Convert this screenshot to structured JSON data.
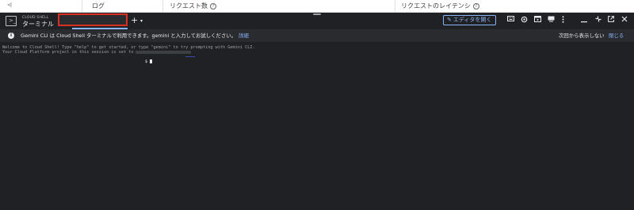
{
  "console_table": {
    "collapse_glyph": "<|",
    "col_logs": "ログ",
    "col_requests": "リクエスト数",
    "col_latency": "リクエストのレイテンシ",
    "help_glyph": "?"
  },
  "toolbar": {
    "brand_small": "CLOUD SHELL",
    "brand_title": "ターミナル",
    "add_tab": "+",
    "tab_menu": "▾",
    "open_editor_label": "エディタを開く",
    "icons": [
      "keyboard-icon",
      "settings-icon",
      "web-preview-icon",
      "display-icon",
      "more-vert-icon",
      "minimize-icon",
      "restore-icon",
      "open-new-window-icon",
      "close-icon"
    ]
  },
  "banner": {
    "text": "Gemini CLI は Cloud Shell ターミナルで利用できます。gemini と入力してお試しください。",
    "link": "詳細",
    "dont_show": "次回から表示しない",
    "close": "閉じる"
  },
  "terminal": {
    "welcome": "Welcome to Cloud Shell! Type \"help\" to get started, or type \"gemini\" to try prompting with Gemini CLI.",
    "project_line": "Your Cloud Platform project in this session is set to",
    "prompt": "$"
  }
}
